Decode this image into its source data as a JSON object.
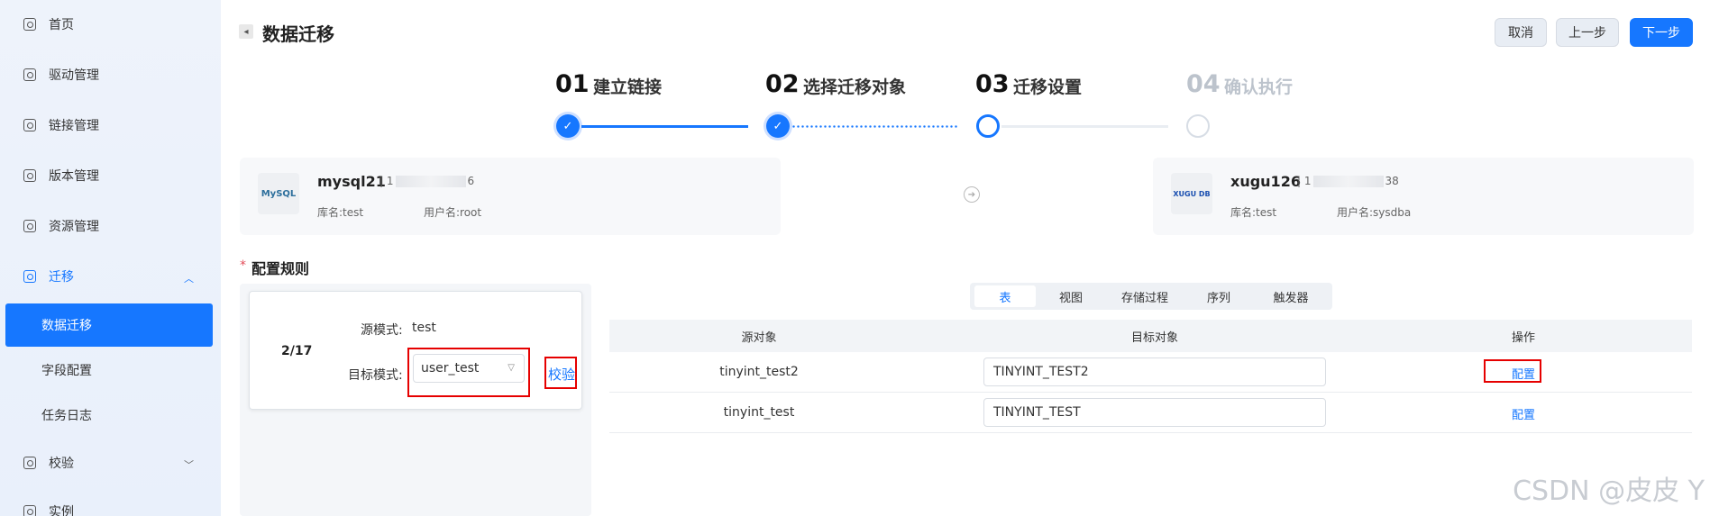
{
  "sidebar": {
    "items": [
      {
        "label": "首页"
      },
      {
        "label": "驱动管理"
      },
      {
        "label": "链接管理"
      },
      {
        "label": "版本管理"
      },
      {
        "label": "资源管理"
      },
      {
        "label": "迁移"
      }
    ],
    "sub_items": [
      {
        "label": "数据迁移"
      },
      {
        "label": "字段配置"
      },
      {
        "label": "任务日志"
      }
    ],
    "after_items": [
      {
        "label": "校验"
      },
      {
        "label": "实例"
      }
    ]
  },
  "header": {
    "title": "数据迁移",
    "cancel_label": "取消",
    "prev_label": "上一步",
    "next_label": "下一步"
  },
  "steps": [
    {
      "num": "01",
      "label": "建立链接",
      "status": "done"
    },
    {
      "num": "02",
      "label": "选择迁移对象",
      "status": "done"
    },
    {
      "num": "03",
      "label": "迁移设置",
      "status": "current"
    },
    {
      "num": "04",
      "label": "确认执行",
      "status": "pending"
    }
  ],
  "source_db": {
    "logo_text": "MySQL",
    "name": "mysql21",
    "ip_prefix": "| 1",
    "ip_suffix": "6",
    "db_label": "库名:test",
    "user_label": "用户名:root"
  },
  "target_db": {
    "logo_text": "XUGU DB",
    "name": "xugu126",
    "ip_prefix": "| 1",
    "ip_suffix": "38",
    "db_label": "库名:test",
    "user_label": "用户名:sysdba"
  },
  "config": {
    "section_title": "配置规则",
    "required_mark": "*",
    "count": "2/17",
    "source_schema_label": "源模式:",
    "source_schema_value": "test",
    "target_schema_label": "目标模式:",
    "target_schema_value": "user_test",
    "verify_label": "校验"
  },
  "tabs": [
    {
      "label": "表",
      "active": true
    },
    {
      "label": "视图",
      "active": false
    },
    {
      "label": "存储过程",
      "active": false
    },
    {
      "label": "序列",
      "active": false
    },
    {
      "label": "触发器",
      "active": false
    }
  ],
  "table": {
    "headers": [
      "源对象",
      "目标对象",
      "操作"
    ],
    "rows": [
      {
        "source": "tinyint_test2",
        "target": "TINYINT_TEST2",
        "action": "配置"
      },
      {
        "source": "tinyint_test",
        "target": "TINYINT_TEST",
        "action": "配置"
      }
    ]
  },
  "watermark": "CSDN @皮皮 Y",
  "colors": {
    "primary": "#1677ff",
    "highlight_box": "#e60000",
    "sidebar_bg": "#eef3fb"
  }
}
